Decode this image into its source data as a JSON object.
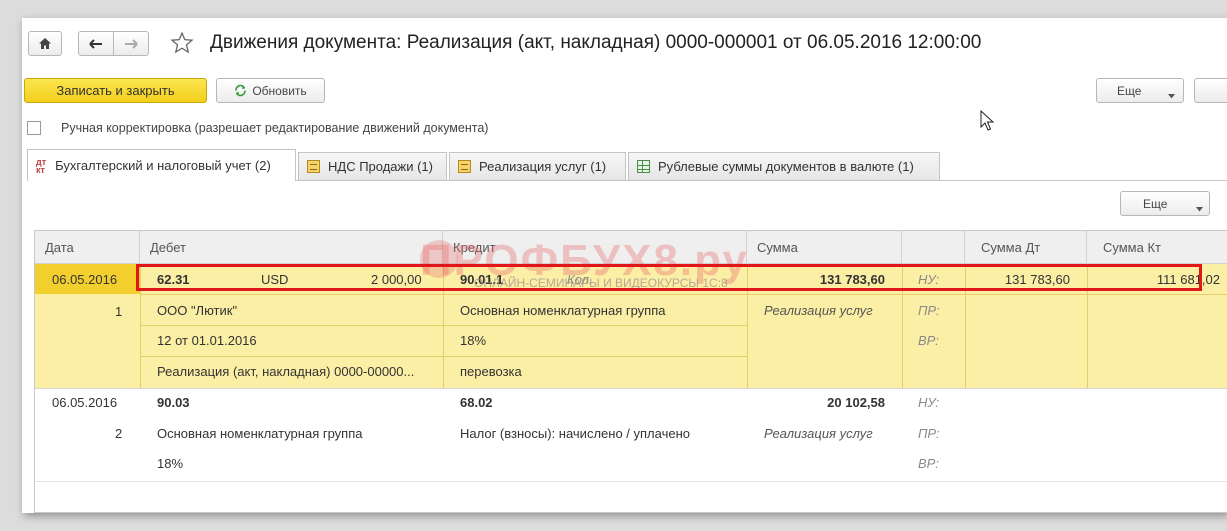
{
  "window": {
    "title": "Движения документа: Реализация (акт, накладная) 0000-000001 от 06.05.2016 12:00:00"
  },
  "toolbar": {
    "save_close": "Записать и закрыть",
    "refresh": "Обновить",
    "more": "Еще"
  },
  "manual_correction": {
    "label": "Ручная корректировка (разрешает редактирование движений документа)",
    "checked": false
  },
  "tabs": [
    {
      "label": "Бухгалтерский и налоговый учет (2)",
      "icon": "dt-kt-icon",
      "active": true
    },
    {
      "label": "НДС Продажи (1)",
      "icon": "register-icon",
      "active": false
    },
    {
      "label": "Реализация услуг (1)",
      "icon": "register-icon",
      "active": false
    },
    {
      "label": "Рублевые суммы документов в валюте (1)",
      "icon": "table-icon",
      "active": false
    }
  ],
  "grid": {
    "more": "Еще",
    "columns": [
      "Дата",
      "Дебет",
      "Кредит",
      "Сумма",
      "",
      "Сумма Дт",
      "Сумма Кт"
    ],
    "rows": [
      {
        "date": "06.05.2016",
        "number": "1",
        "debit": {
          "account": "62.31",
          "currency": "USD",
          "currency_amount": "2 000,00",
          "sub1": "ООО \"Лютик\"",
          "sub2": "12 от 01.01.2016",
          "sub3": "Реализация (акт, накладная) 0000-00000..."
        },
        "credit": {
          "account": "90.01.1",
          "qty_label": "Кол.",
          "sub1": "Основная номенклатурная группа",
          "sub2": "18%",
          "sub3": "перевозка"
        },
        "sum": "131 783,60",
        "content": "Реализация услуг",
        "labels": [
          "НУ:",
          "ПР:",
          "ВР:"
        ],
        "sum_dt": "131 783,60",
        "sum_kt": "111 681,02"
      },
      {
        "date": "06.05.2016",
        "number": "2",
        "debit": {
          "account": "90.03",
          "sub1": "Основная номенклатурная группа",
          "sub2": "18%"
        },
        "credit": {
          "account": "68.02",
          "sub1": "Налог (взносы): начислено / уплачено"
        },
        "sum": "20 102,58",
        "content": "Реализация услуг",
        "labels": [
          "НУ:",
          "ПР:",
          "ВР:"
        ]
      }
    ]
  },
  "watermark": {
    "text": "ПРОФБУХ8.ру",
    "sub": "ОНЛАЙН-СЕМИНАРЫ И ВИДЕОКУРСЫ 1С:8"
  }
}
